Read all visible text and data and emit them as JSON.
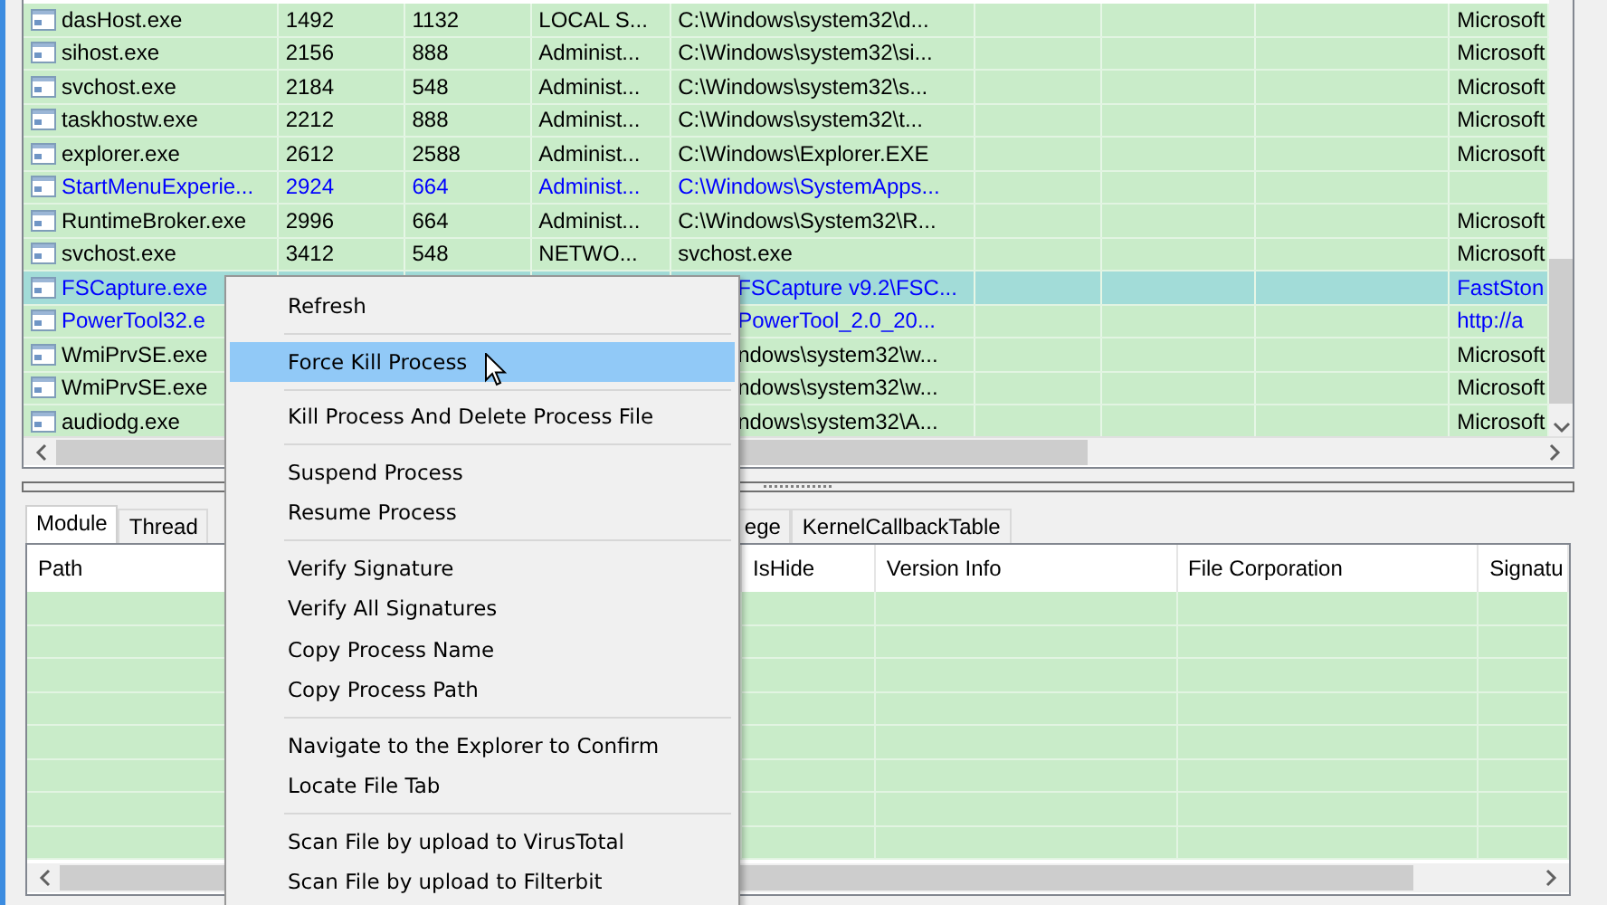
{
  "process_table": {
    "rows": [
      {
        "cells": [
          "dasHost.exe",
          "1492",
          "1132",
          "LOCAL S...",
          "C:\\Windows\\system32\\d...",
          null,
          null,
          null,
          "Microsoft"
        ],
        "color": "#000000",
        "selected": false
      },
      {
        "cells": [
          "sihost.exe",
          "2156",
          "888",
          "Administ...",
          "C:\\Windows\\system32\\si...",
          null,
          null,
          null,
          "Microsoft"
        ],
        "color": "#000000",
        "selected": false
      },
      {
        "cells": [
          "svchost.exe",
          "2184",
          "548",
          "Administ...",
          "C:\\Windows\\system32\\s...",
          null,
          null,
          null,
          "Microsoft"
        ],
        "color": "#000000",
        "selected": false
      },
      {
        "cells": [
          "taskhostw.exe",
          "2212",
          "888",
          "Administ...",
          "C:\\Windows\\system32\\t...",
          null,
          null,
          null,
          "Microsoft"
        ],
        "color": "#000000",
        "selected": false
      },
      {
        "cells": [
          "explorer.exe",
          "2612",
          "2588",
          "Administ...",
          "C:\\Windows\\Explorer.EXE",
          null,
          null,
          null,
          "Microsoft"
        ],
        "color": "#000000",
        "selected": false
      },
      {
        "cells": [
          "StartMenuExperie...",
          "2924",
          "664",
          "Administ...",
          "C:\\Windows\\SystemApps...",
          null,
          null,
          null,
          null
        ],
        "color": "#0000ff",
        "selected": false
      },
      {
        "cells": [
          "RuntimeBroker.exe",
          "2996",
          "664",
          "Administ...",
          "C:\\Windows\\System32\\R...",
          null,
          null,
          null,
          "Microsoft"
        ],
        "color": "#000000",
        "selected": false
      },
      {
        "cells": [
          "svchost.exe",
          "3412",
          "548",
          "NETWO...",
          "svchost.exe",
          null,
          null,
          null,
          "Microsoft"
        ],
        "color": "#000000",
        "selected": false
      },
      {
        "cells": [
          "FSCapture.exe",
          null,
          null,
          null,
          "FSCapture v9.2\\FSC...",
          null,
          null,
          null,
          "FastSton"
        ],
        "color": "#0000ff",
        "selected": true
      },
      {
        "cells": [
          "PowerTool32.e",
          null,
          null,
          null,
          "PowerTool_2.0_20...",
          null,
          null,
          null,
          "http://a"
        ],
        "color": "#0000ff",
        "selected": false
      },
      {
        "cells": [
          "WmiPrvSE.exe",
          null,
          null,
          null,
          "ndows\\system32\\w...",
          null,
          null,
          null,
          "Microsoft"
        ],
        "color": "#000000",
        "selected": false
      },
      {
        "cells": [
          "WmiPrvSE.exe",
          null,
          null,
          null,
          "ndows\\system32\\w...",
          null,
          null,
          null,
          "Microsoft"
        ],
        "color": "#000000",
        "selected": false
      },
      {
        "cells": [
          "audiodg.exe",
          null,
          null,
          null,
          "ndows\\system32\\A...",
          null,
          null,
          null,
          "Microsoft"
        ],
        "color": "#000000",
        "selected": false
      }
    ]
  },
  "tabs": {
    "left": [
      {
        "label": "Module",
        "selected": true
      },
      {
        "label": "Thread",
        "selected": false
      }
    ],
    "right": [
      {
        "label": "ege",
        "selected": false
      },
      {
        "label": "KernelCallbackTable",
        "selected": false
      }
    ]
  },
  "module_table": {
    "columns": [
      {
        "label": "Path"
      },
      {
        "label": "IsHide"
      },
      {
        "label": "Version Info"
      },
      {
        "label": "File Corporation"
      },
      {
        "label": "Signatu"
      }
    ]
  },
  "context_menu": {
    "items": [
      {
        "kind": "item",
        "label": "Refresh",
        "selected": false
      },
      {
        "kind": "separator"
      },
      {
        "kind": "item",
        "label": "Force Kill Process",
        "selected": true
      },
      {
        "kind": "separator"
      },
      {
        "kind": "item",
        "label": "Kill Process And Delete Process File",
        "selected": false
      },
      {
        "kind": "separator"
      },
      {
        "kind": "item",
        "label": "Suspend Process",
        "selected": false
      },
      {
        "kind": "item",
        "label": "Resume Process",
        "selected": false
      },
      {
        "kind": "separator"
      },
      {
        "kind": "item",
        "label": "Verify Signature",
        "selected": false
      },
      {
        "kind": "item",
        "label": "Verify All Signatures",
        "selected": false
      },
      {
        "kind": "item",
        "label": "Copy Process Name",
        "selected": false
      },
      {
        "kind": "item",
        "label": "Copy Process Path",
        "selected": false
      },
      {
        "kind": "separator"
      },
      {
        "kind": "item",
        "label": "Navigate to the Explorer to Confirm",
        "selected": false
      },
      {
        "kind": "item",
        "label": "Locate File Tab",
        "selected": false
      },
      {
        "kind": "separator"
      },
      {
        "kind": "item",
        "label": "Scan File by upload to VirusTotal",
        "selected": false
      },
      {
        "kind": "item",
        "label": "Scan File by upload to Filterbit",
        "selected": false
      }
    ]
  }
}
